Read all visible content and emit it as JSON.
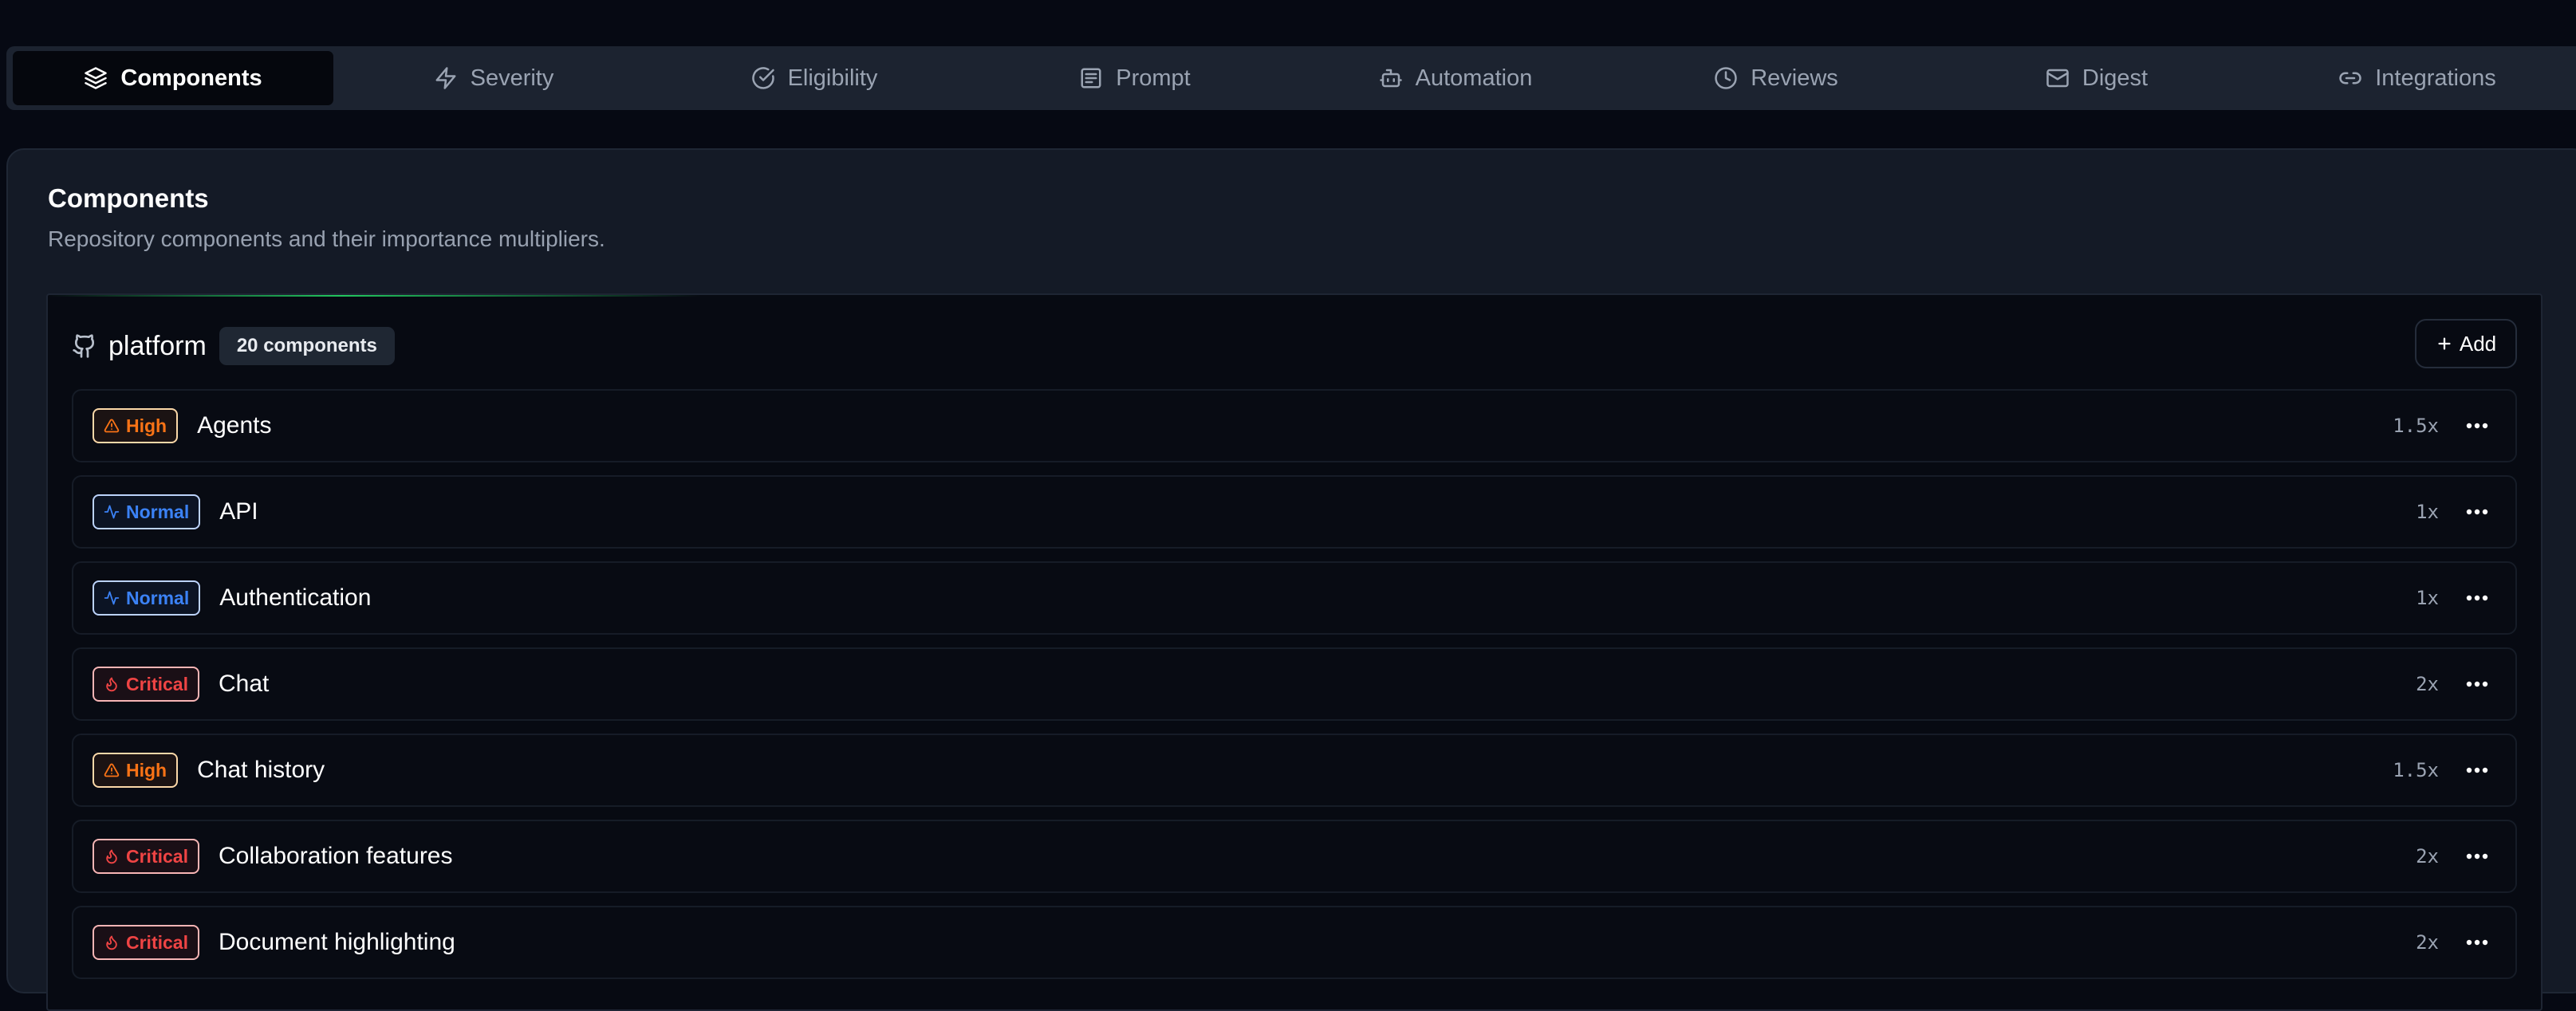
{
  "tabs": [
    {
      "label": "Components",
      "icon": "layers-icon",
      "active": true
    },
    {
      "label": "Severity",
      "icon": "lightning-icon",
      "active": false
    },
    {
      "label": "Eligibility",
      "icon": "check-circle-icon",
      "active": false
    },
    {
      "label": "Prompt",
      "icon": "message-square-icon",
      "active": false
    },
    {
      "label": "Automation",
      "icon": "bot-icon",
      "active": false
    },
    {
      "label": "Reviews",
      "icon": "clock-icon",
      "active": false
    },
    {
      "label": "Digest",
      "icon": "mail-icon",
      "active": false
    },
    {
      "label": "Integrations",
      "icon": "link-icon",
      "active": false
    }
  ],
  "card": {
    "title": "Components",
    "description": "Repository components and their importance multipliers."
  },
  "repo": {
    "name": "platform",
    "count_label": "20 components",
    "add_label": "Add",
    "icon": "github-icon"
  },
  "components": [
    {
      "level": "High",
      "name": "Agents",
      "multiplier": "1.5x"
    },
    {
      "level": "Normal",
      "name": "API",
      "multiplier": "1x"
    },
    {
      "level": "Normal",
      "name": "Authentication",
      "multiplier": "1x"
    },
    {
      "level": "Critical",
      "name": "Chat",
      "multiplier": "2x"
    },
    {
      "level": "High",
      "name": "Chat history",
      "multiplier": "1.5x"
    },
    {
      "level": "Critical",
      "name": "Collaboration features",
      "multiplier": "2x"
    },
    {
      "level": "Critical",
      "name": "Document highlighting",
      "multiplier": "2x"
    }
  ],
  "colors": {
    "high": "#f97316",
    "normal": "#3b82f6",
    "critical": "#ef4444",
    "accent": "#22c55e"
  }
}
